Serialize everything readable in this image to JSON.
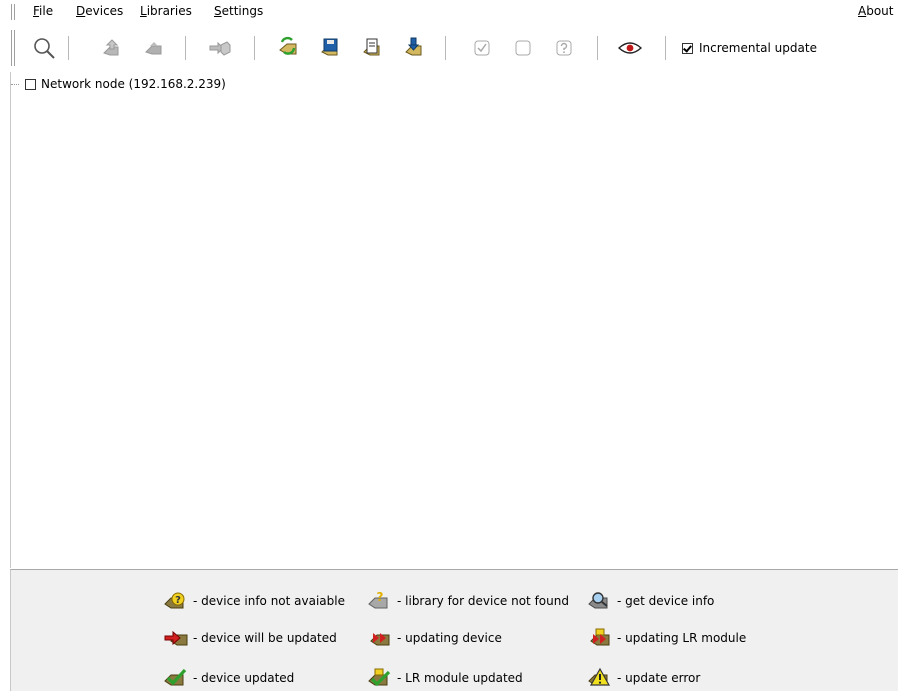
{
  "menu": {
    "file": "File",
    "devices": "Devices",
    "libraries": "Libraries",
    "settings": "Settings",
    "about": "About"
  },
  "toolbar": {
    "incremental_update_label": "Incremental update",
    "incremental_update_checked": true,
    "icons": [
      "search-icon",
      "upload-device-icon",
      "download-device-icon",
      "device-arrow-icon",
      "refresh-icon",
      "save-icon",
      "copy-icon",
      "download-library-icon",
      "check-all-icon",
      "uncheck-all-icon",
      "query-icon",
      "view-icon"
    ]
  },
  "tree": {
    "node_label": "Network node (192.168.2.239)",
    "node_checked": false
  },
  "legend": {
    "info_not_available": "- device info not avaiable",
    "library_not_found": "- library for device not found",
    "get_device_info": "- get device info",
    "will_be_updated": "- device will be updated",
    "updating_device": "- updating device",
    "updating_lr_module": "- updating LR module",
    "device_updated": "- device updated",
    "lr_module_updated": "- LR module updated",
    "update_error": "- update error"
  },
  "colors": {
    "legend_bg": "#f0f0f0",
    "device_gold": "#c8a850",
    "accent_green": "#2ea02e",
    "accent_red": "#d02020",
    "accent_blue": "#1e5fa8"
  }
}
